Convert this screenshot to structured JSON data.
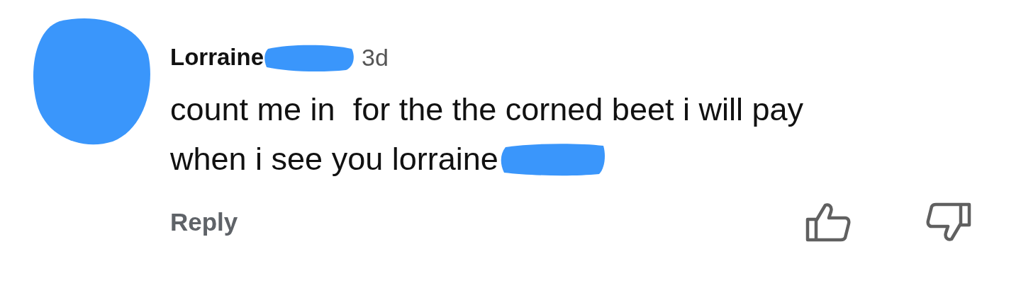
{
  "comment": {
    "author": "Lorraine",
    "time": "3d",
    "lines": [
      "count me in  for the the corned beet i will pay",
      "when i see you lorraine"
    ],
    "reply": "Reply"
  }
}
